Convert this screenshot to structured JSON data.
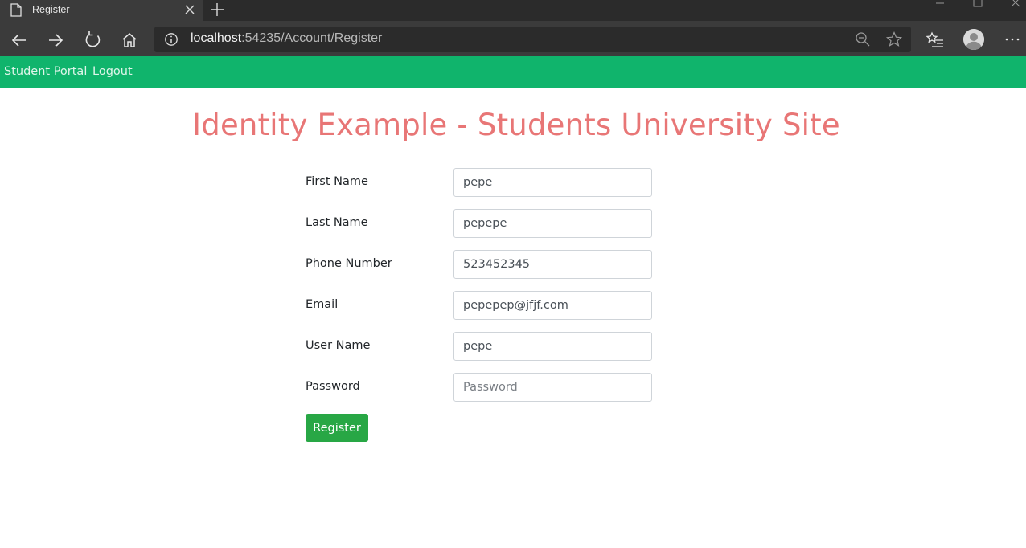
{
  "browser": {
    "tab_title": "Register",
    "url_host": "localhost",
    "url_rest": ":54235/Account/Register",
    "icons": [
      "page-icon",
      "close-icon",
      "plus-icon",
      "back-arrow-icon",
      "forward-arrow-icon",
      "refresh-icon",
      "home-icon",
      "info-icon",
      "zoom-out-icon",
      "star-icon",
      "favorites-icon",
      "avatar-icon",
      "more-icon"
    ]
  },
  "appnav": {
    "brand": "Student Portal",
    "logout": "Logout",
    "color": "#10b46c"
  },
  "main": {
    "title": "Identity Example - Students University Site",
    "title_color": "#e87676",
    "form": {
      "first_name": {
        "label": "First Name",
        "value": "pepe"
      },
      "last_name": {
        "label": "Last Name",
        "value": "pepepe"
      },
      "phone": {
        "label": "Phone Number",
        "value": "523452345"
      },
      "email": {
        "label": "Email",
        "value": "pepepep@jfjf.com"
      },
      "user_name": {
        "label": "User Name",
        "value": "pepe"
      },
      "password": {
        "label": "Password",
        "value": "",
        "placeholder": "Password"
      }
    },
    "submit_label": "Register",
    "submit_color": "#28a745"
  }
}
